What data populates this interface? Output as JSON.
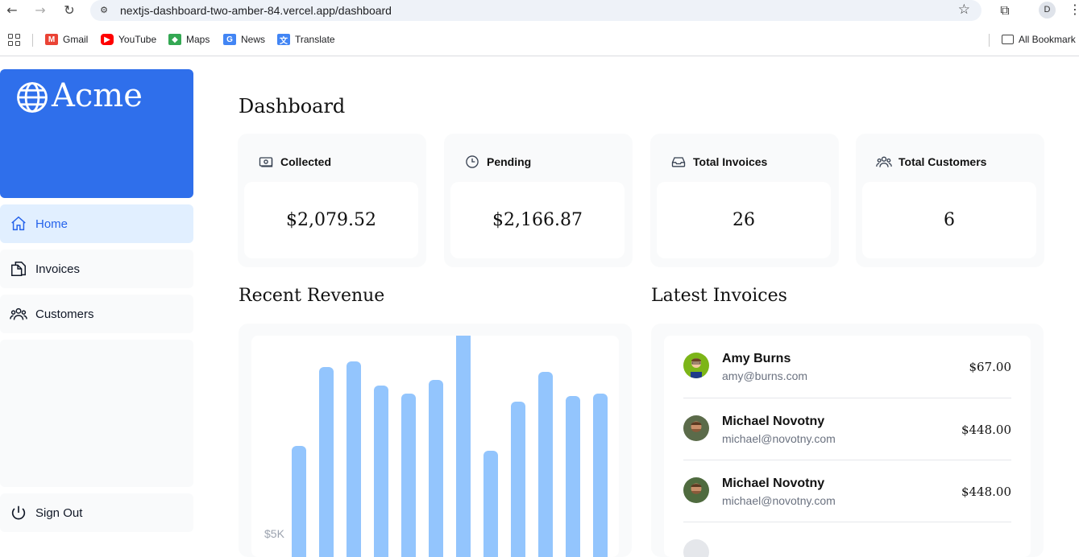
{
  "browser": {
    "url": "nextjs-dashboard-two-amber-84.vercel.app/dashboard",
    "profile_initial": "D",
    "bookmarks": [
      {
        "label": "Gmail",
        "icon": "gmail-icon",
        "color": "#ea4335"
      },
      {
        "label": "YouTube",
        "icon": "youtube-icon",
        "color": "#ff0000"
      },
      {
        "label": "Maps",
        "icon": "maps-icon",
        "color": "#34a853"
      },
      {
        "label": "News",
        "icon": "news-icon",
        "color": "#4285f4"
      },
      {
        "label": "Translate",
        "icon": "translate-icon",
        "color": "#4285f4"
      }
    ],
    "all_bookmarks": "All Bookmark"
  },
  "sidebar": {
    "logo": "Acme",
    "accent": "#2f6feb",
    "items": [
      {
        "label": "Home",
        "icon": "home-icon",
        "active": true
      },
      {
        "label": "Invoices",
        "icon": "document-icon",
        "active": false
      },
      {
        "label": "Customers",
        "icon": "users-icon",
        "active": false
      }
    ],
    "sign_out": "Sign Out"
  },
  "main": {
    "title": "Dashboard",
    "cards": [
      {
        "label": "Collected",
        "icon": "banknotes-icon",
        "value": "$2,079.52"
      },
      {
        "label": "Pending",
        "icon": "clock-icon",
        "value": "$2,166.87"
      },
      {
        "label": "Total Invoices",
        "icon": "inbox-icon",
        "value": "26"
      },
      {
        "label": "Total Customers",
        "icon": "users-icon",
        "value": "6"
      }
    ],
    "revenue_title": "Recent Revenue",
    "invoices_title": "Latest Invoices",
    "latest_invoices": [
      {
        "name": "Amy Burns",
        "email": "amy@burns.com",
        "amount": "$67.00"
      },
      {
        "name": "Michael Novotny",
        "email": "michael@novotny.com",
        "amount": "$448.00"
      },
      {
        "name": "Michael Novotny",
        "email": "michael@novotny.com",
        "amount": "$448.00"
      }
    ]
  },
  "chart_data": {
    "type": "bar",
    "title": "Recent Revenue",
    "y_tick_labels": [
      "$5K"
    ],
    "values": [
      4900,
      7850,
      8050,
      7150,
      6850,
      7350,
      9200,
      4700,
      6550,
      7650,
      6750,
      6850
    ],
    "color": "#93c5fd"
  }
}
